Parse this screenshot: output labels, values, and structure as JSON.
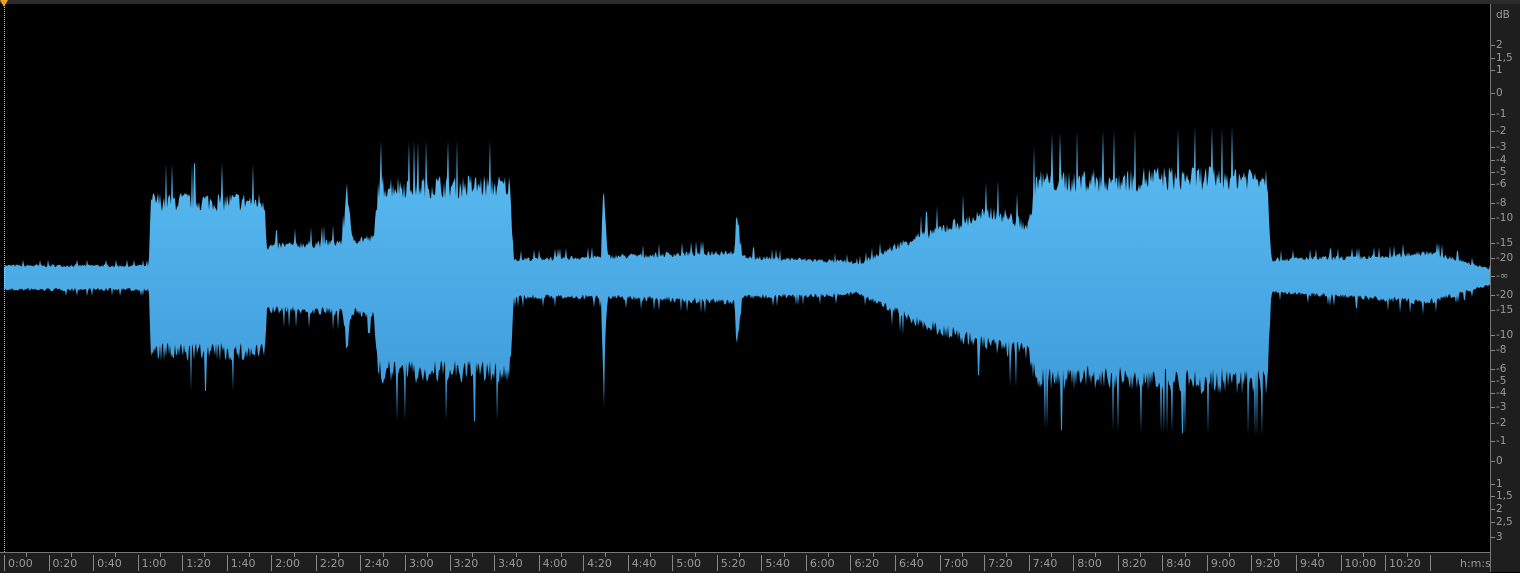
{
  "colors": {
    "waveform_top": "#5cbef4",
    "waveform_bottom": "#3b97d6",
    "playhead": "#e8d040",
    "marker": "#f0a020"
  },
  "db_scale": {
    "unit": "dB",
    "upper_labels": [
      "2",
      "1,5",
      "1",
      "0",
      "-1",
      "-2",
      "-3",
      "-4",
      "-5",
      "-6",
      "-8",
      "-10",
      "-15",
      "-20",
      "-∞"
    ],
    "lower_labels": [
      "-20",
      "-15",
      "-10",
      "-8",
      "-6",
      "-5",
      "-4",
      "-3",
      "-2",
      "-1",
      "0",
      "1",
      "1,5",
      "2",
      "2,5",
      "3"
    ]
  },
  "time_ruler": {
    "labels": [
      "0:00",
      "0:20",
      "0:40",
      "1:00",
      "1:20",
      "1:40",
      "2:00",
      "2:20",
      "2:40",
      "3:00",
      "3:20",
      "3:40",
      "4:00",
      "4:20",
      "4:40",
      "5:00",
      "5:20",
      "5:40",
      "6:00",
      "6:20",
      "6:40",
      "7:00",
      "7:20",
      "7:40",
      "8:00",
      "8:20",
      "8:40",
      "9:00",
      "9:20",
      "9:40",
      "10:00",
      "10:20"
    ],
    "unit_label": "h:m:s"
  },
  "waveform_envelope_seconds": [
    [
      0,
      0.045,
      0.05
    ],
    [
      65,
      0.045,
      0.05
    ],
    [
      66,
      0.3,
      0.3
    ],
    [
      117,
      0.3,
      0.3
    ],
    [
      118,
      0.12,
      0.13
    ],
    [
      152,
      0.14,
      0.14
    ],
    [
      154,
      0.38,
      0.3
    ],
    [
      156,
      0.15,
      0.14
    ],
    [
      166,
      0.15,
      0.15
    ],
    [
      168,
      0.36,
      0.38
    ],
    [
      227,
      0.36,
      0.38
    ],
    [
      229,
      0.07,
      0.08
    ],
    [
      268,
      0.08,
      0.08
    ],
    [
      269,
      0.36,
      0.4
    ],
    [
      271,
      0.08,
      0.08
    ],
    [
      328,
      0.1,
      0.1
    ],
    [
      329,
      0.28,
      0.3
    ],
    [
      331,
      0.08,
      0.08
    ],
    [
      380,
      0.06,
      0.07
    ],
    [
      383,
      0.05,
      0.06
    ],
    [
      410,
      0.16,
      0.18
    ],
    [
      445,
      0.26,
      0.28
    ],
    [
      460,
      0.2,
      0.3
    ],
    [
      463,
      0.38,
      0.4
    ],
    [
      567,
      0.4,
      0.42
    ],
    [
      569,
      0.07,
      0.06
    ],
    [
      620,
      0.08,
      0.09
    ],
    [
      640,
      0.1,
      0.1
    ],
    [
      668,
      0.03,
      0.03
    ]
  ]
}
